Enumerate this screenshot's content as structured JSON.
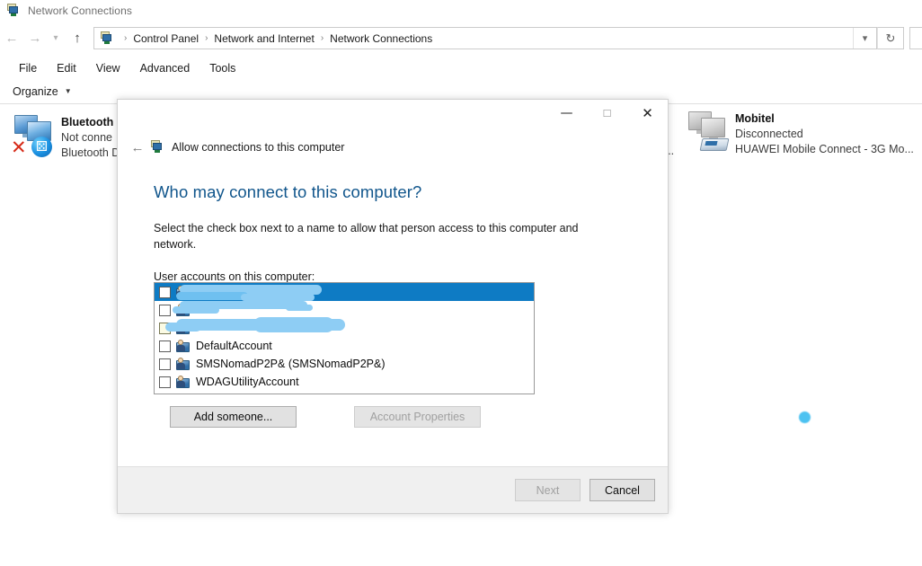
{
  "window": {
    "title": "Network Connections",
    "icon": "network-connections-icon"
  },
  "nav": {
    "back_icon": "arrow-left-icon",
    "forward_icon": "arrow-right-icon",
    "recent_icon": "chevron-down-icon",
    "up_icon": "arrow-up-icon",
    "dropdown_icon": "chevron-down-icon",
    "refresh_icon": "refresh-icon"
  },
  "breadcrumb": {
    "icon": "network-connections-icon",
    "items": [
      "Control Panel",
      "Network and Internet",
      "Network Connections"
    ],
    "separator": "›"
  },
  "menubar": {
    "items": [
      "File",
      "Edit",
      "View",
      "Advanced",
      "Tools"
    ]
  },
  "toolbar": {
    "organize_label": "Organize",
    "organize_caret": "▼"
  },
  "connections": [
    {
      "name": "Bluetooth N",
      "status": "Not conne",
      "device": "Bluetooth D",
      "icon": "bluetooth-network-icon",
      "disabled_icon": "red-x-icon"
    },
    {
      "name": "Mobitel",
      "status": "Disconnected",
      "device": "HUAWEI Mobile Connect - 3G Mo...",
      "icon": "modem-network-icon"
    }
  ],
  "background_peek_text": "l I...",
  "dialog": {
    "titlebar": {
      "minimize_icon": "—",
      "maximize_icon": "☐",
      "close_icon": "✕"
    },
    "back_icon": "arrow-left-icon",
    "header_icon": "network-connections-icon",
    "header_text": "Allow connections to this computer",
    "heading": "Who may connect to this computer?",
    "paragraph": "Select the check box next to a name to allow that person access to this computer and network.",
    "list_label": "User accounts on this computer:",
    "accounts": [
      {
        "name": "",
        "checked": false,
        "selected": true,
        "redacted": true,
        "checkbox_style": "normal"
      },
      {
        "name": "",
        "checked": false,
        "selected": false,
        "redacted": true,
        "checkbox_style": "normal"
      },
      {
        "name": "",
        "checked": false,
        "selected": false,
        "redacted": true,
        "checkbox_style": "cream"
      },
      {
        "name": "DefaultAccount",
        "checked": false,
        "selected": false,
        "redacted": false,
        "checkbox_style": "normal"
      },
      {
        "name": "SMSNomadP2P& (SMSNomadP2P&)",
        "checked": false,
        "selected": false,
        "redacted": false,
        "checkbox_style": "normal"
      },
      {
        "name": "WDAGUtilityAccount",
        "checked": false,
        "selected": false,
        "redacted": false,
        "checkbox_style": "normal"
      }
    ],
    "buttons": {
      "add_someone": "Add someone...",
      "account_properties": "Account Properties",
      "next": "Next",
      "cancel": "Cancel"
    }
  },
  "colors": {
    "selection_blue": "#0e7bc4",
    "heading_blue": "#11568c",
    "redaction_blue": "#8ecdf4"
  }
}
